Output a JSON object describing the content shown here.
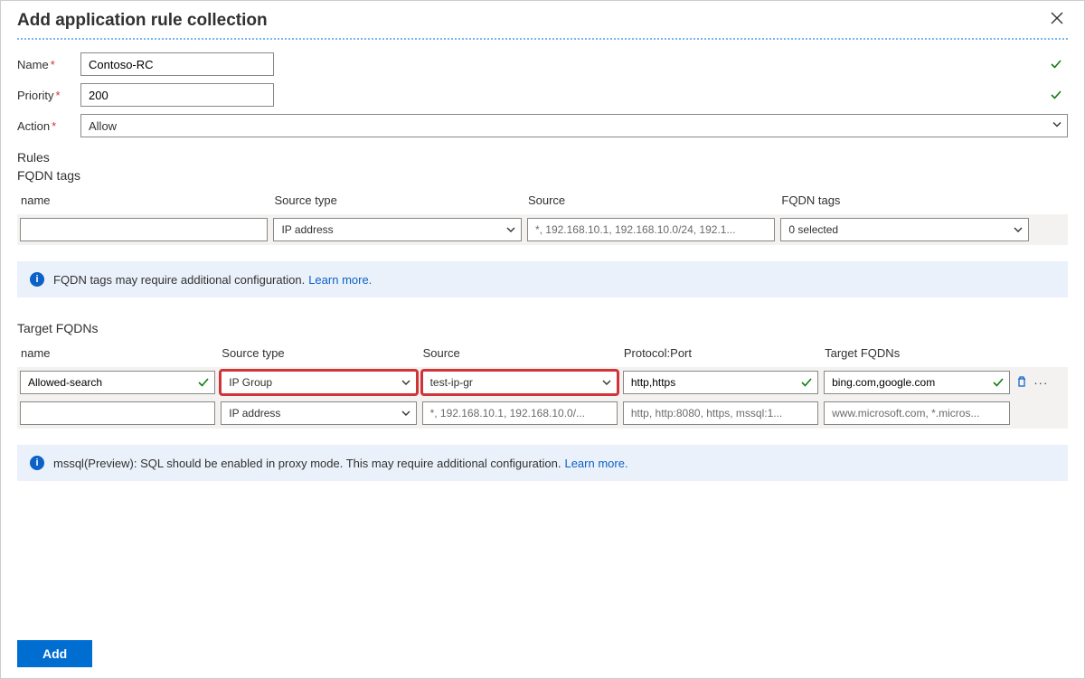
{
  "header": {
    "title": "Add application rule collection"
  },
  "form": {
    "name_label": "Name",
    "name_value": "Contoso-RC",
    "priority_label": "Priority",
    "priority_value": "200",
    "action_label": "Action",
    "action_value": "Allow"
  },
  "rules_label": "Rules",
  "fqdn_tags": {
    "title": "FQDN tags",
    "headers": {
      "name": "name",
      "source_type": "Source type",
      "source": "Source",
      "tags": "FQDN tags"
    },
    "new_row": {
      "source_type": "IP address",
      "source_ph": "*, 192.168.10.1, 192.168.10.0/24, 192.1...",
      "tags_value": "0 selected"
    }
  },
  "info1": {
    "text": "FQDN tags may require additional configuration.",
    "link": "Learn more."
  },
  "target_fqdns": {
    "title": "Target FQDNs",
    "headers": {
      "name": "name",
      "source_type": "Source type",
      "source": "Source",
      "proto": "Protocol:Port",
      "tfq": "Target FQDNs"
    },
    "row1": {
      "name": "Allowed-search",
      "source_type": "IP Group",
      "source": "test-ip-gr",
      "proto": "http,https",
      "tfq": "bing.com,google.com"
    },
    "new_row": {
      "source_type": "IP address",
      "source_ph": "*, 192.168.10.1, 192.168.10.0/...",
      "proto_ph": "http, http:8080, https, mssql:1...",
      "tfq_ph": "www.microsoft.com, *.micros..."
    }
  },
  "info2": {
    "text": "mssql(Preview): SQL should be enabled in proxy mode. This may require additional configuration.",
    "link": "Learn more."
  },
  "add_button": "Add"
}
